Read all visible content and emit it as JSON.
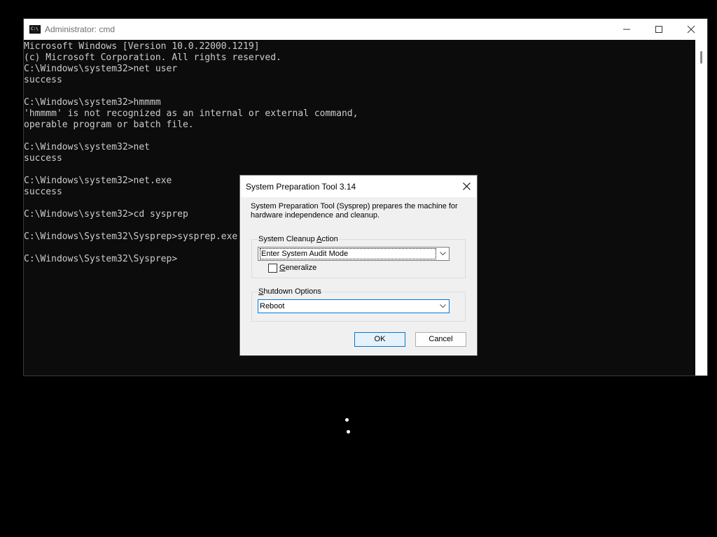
{
  "cmd": {
    "title": "Administrator: cmd",
    "app_icon": "cmd-icon",
    "controls": [
      "minimize-icon",
      "maximize-icon",
      "close-icon"
    ],
    "lines": [
      "Microsoft Windows [Version 10.0.22000.1219]",
      "(c) Microsoft Corporation. All rights reserved.",
      "C:\\Windows\\system32>net user",
      "success",
      "",
      "C:\\Windows\\system32>hmmmm",
      "'hmmmm' is not recognized as an internal or external command,",
      "operable program or batch file.",
      "",
      "C:\\Windows\\system32>net",
      "success",
      "",
      "C:\\Windows\\system32>net.exe",
      "success",
      "",
      "C:\\Windows\\system32>cd sysprep",
      "",
      "C:\\Windows\\System32\\Sysprep>sysprep.exe",
      "",
      "C:\\Windows\\System32\\Sysprep>"
    ]
  },
  "dialog": {
    "title": "System Preparation Tool 3.14",
    "description": "System Preparation Tool (Sysprep) prepares the machine for hardware independence and cleanup.",
    "cleanup_group": {
      "label_prefix": "System Cleanup ",
      "label_accel": "A",
      "label_suffix": "ction",
      "selected": "Enter System Audit Mode"
    },
    "generalize": {
      "label_accel": "G",
      "label_rest": "eneralize",
      "checked": false
    },
    "shutdown_group": {
      "label_accel": "S",
      "label_rest": "hutdown Options",
      "selected": "Reboot"
    },
    "buttons": {
      "ok": "OK",
      "cancel": "Cancel"
    }
  }
}
